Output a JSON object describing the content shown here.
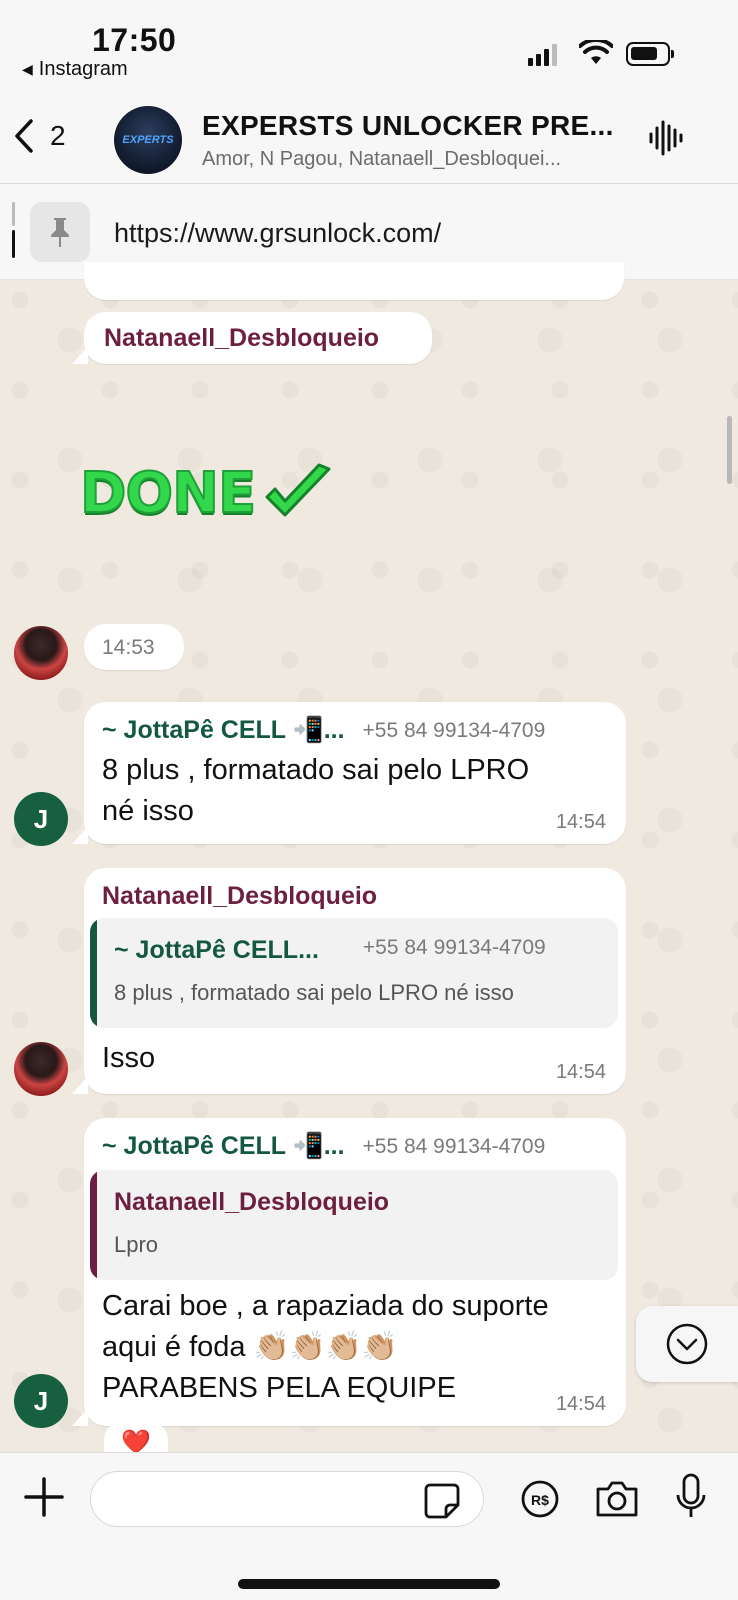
{
  "status_bar": {
    "time": "17:50",
    "back_app": "Instagram"
  },
  "header": {
    "back_count": "2",
    "avatar_text": "EXPERTS",
    "title": "EXPERSTS UNLOCKER PRE...",
    "subtitle": "Amor, N Pagou, Natanaell_Desbloquei..."
  },
  "pinned": {
    "url": "https://www.grsunlock.com/"
  },
  "messages": [
    {
      "sender": "Natanaell_Desbloqueio",
      "sticker_text": "DONE",
      "sticker_check": "✔",
      "time": "14:53"
    },
    {
      "sender": "~ JottaPê CELL 📲...",
      "phone": "+55 84 99134-4709",
      "text_line1": "8 plus , formatado sai pelo LPRO",
      "text_line2": "né isso",
      "time": "14:54",
      "avatar_letter": "J"
    },
    {
      "sender": "Natanaell_Desbloqueio",
      "quote_sender": "~ JottaPê CELL...",
      "quote_phone": "+55 84 99134-4709",
      "quote_text": "8 plus , formatado sai pelo LPRO né isso",
      "text": "Isso",
      "time": "14:54"
    },
    {
      "sender": "~ JottaPê CELL 📲...",
      "phone": "+55 84 99134-4709",
      "quote_sender": "Natanaell_Desbloqueio",
      "quote_text": "Lpro",
      "text_line1": "Carai boe , a rapaziada do suporte",
      "text_line2": "aqui é foda 👏🏼👏🏼👏🏼👏🏼",
      "text_line3": "PARABENS PELA EQUIPE",
      "time": "14:54",
      "avatar_letter": "J",
      "reaction": "❤️"
    }
  ],
  "input": {
    "placeholder": ""
  },
  "colors": {
    "sender_maroon": "#6d1f3f",
    "sender_green": "#14593f",
    "quote_bar_green": "#14593f",
    "quote_bar_maroon": "#6d1f3f",
    "done_green": "#32d74b"
  },
  "icons": [
    "back-chevron-icon",
    "voice-wave-icon",
    "pin-icon",
    "chevron-down-icon",
    "plus-icon",
    "sticker-icon",
    "payment-icon",
    "camera-icon",
    "mic-icon"
  ]
}
